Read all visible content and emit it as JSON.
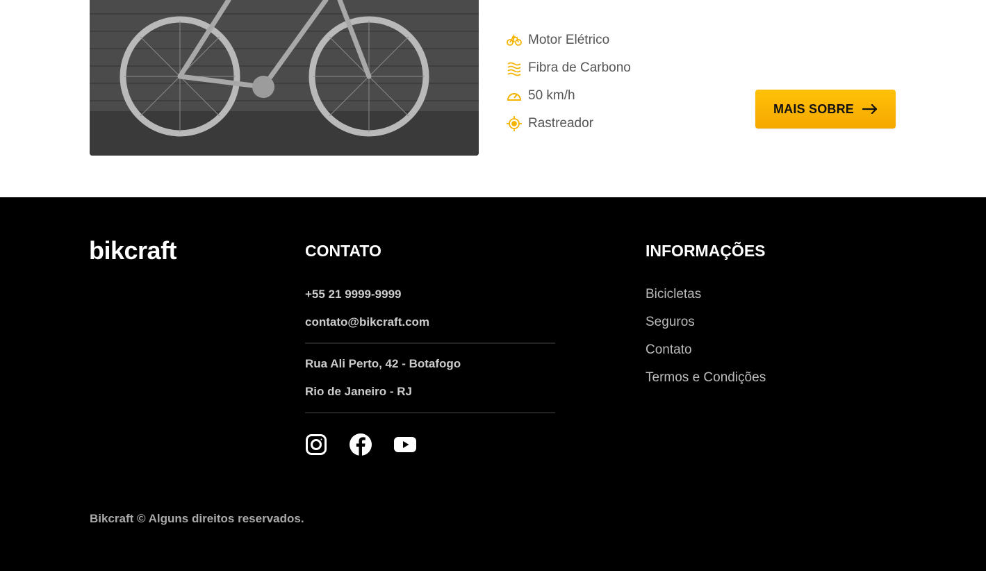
{
  "product": {
    "features": [
      {
        "icon": "electric-bike-icon",
        "label": "Motor Elétrico"
      },
      {
        "icon": "carbon-fiber-icon",
        "label": "Fibra de Carbono"
      },
      {
        "icon": "speedometer-icon",
        "label": "50 km/h"
      },
      {
        "icon": "tracker-icon",
        "label": "Rastreador"
      }
    ],
    "more_button": {
      "label": "MAIS SOBRE",
      "icon": "arrow-right-icon"
    }
  },
  "footer": {
    "logo": "bikcraft",
    "contact": {
      "title": "CONTATO",
      "phone": "+55 21 9999-9999",
      "email": "contato@bikcraft.com",
      "address_line1": "Rua Ali Perto, 42 - Botafogo",
      "address_line2": "Rio de Janeiro - RJ",
      "social": [
        "instagram-icon",
        "facebook-icon",
        "youtube-icon"
      ]
    },
    "info": {
      "title": "INFORMAÇÕES",
      "links": [
        "Bicicletas",
        "Seguros",
        "Contato",
        "Termos e Condições"
      ]
    },
    "copyright": "Bikcraft © Alguns direitos reservados."
  },
  "colors": {
    "accent": "#ffbb00",
    "footer_bg": "#000000",
    "icon_yellow": "#f5b400"
  }
}
